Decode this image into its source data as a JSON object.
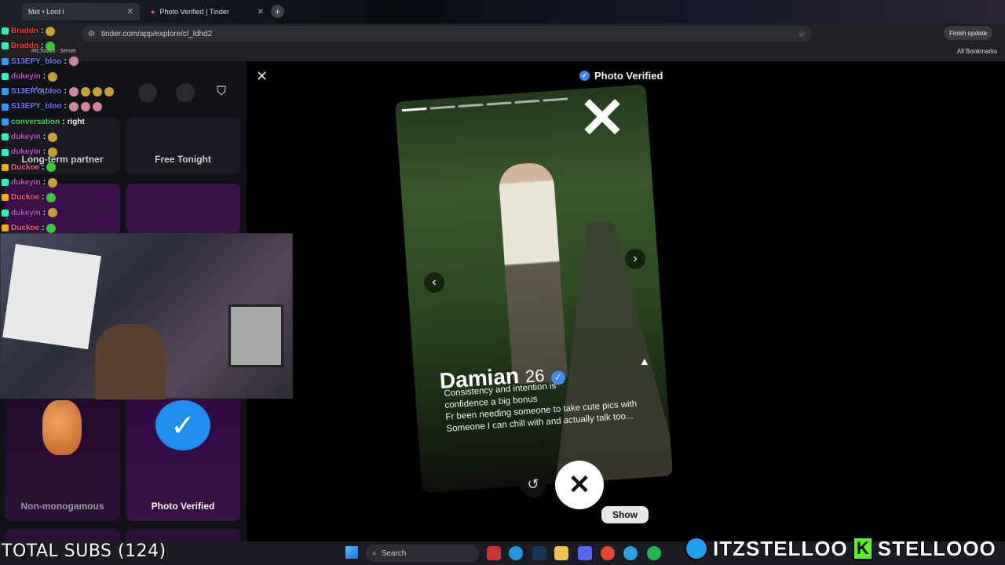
{
  "browser": {
    "tabs": [
      {
        "label": "Met • Lord i",
        "active": true
      },
      {
        "label": "Photo Verified | Tinder",
        "active": false
      }
    ],
    "url": "tinder.com/app/explore/cl_ldhd2",
    "finish_update": "Finish update",
    "bookmark_item": "IRLToolkit - Server",
    "all_bookmarks": "All Bookmarks"
  },
  "chat": [
    {
      "user": "Braddn",
      "color": "#ff3b3b",
      "msg": "",
      "emote": true
    },
    {
      "user": "Braddn",
      "color": "#ff3b3b",
      "msg": "",
      "emote": true
    },
    {
      "user": "S13EPY_bloo",
      "color": "#6f7cff",
      "msg": "",
      "emote": true
    },
    {
      "user": "dukeyin",
      "color": "#d14bd4",
      "msg": "",
      "emote": true
    },
    {
      "user": "S13EPY_bloo",
      "color": "#6f7cff",
      "msg": "",
      "emote": true
    },
    {
      "user": "S13EPY_bloo",
      "color": "#6f7cff",
      "msg": "",
      "emote": true
    },
    {
      "user": "conversation",
      "color": "#44d36a",
      "msg": "right",
      "emote": false
    },
    {
      "user": "dukeyin",
      "color": "#d14bd4",
      "msg": "",
      "emote": true
    },
    {
      "user": "dukeyin",
      "color": "#d14bd4",
      "msg": "",
      "emote": true
    },
    {
      "user": "Duckoe",
      "color": "#ff5b9c",
      "msg": "",
      "emote": true
    },
    {
      "user": "dukeyin",
      "color": "#d14bd4",
      "msg": "",
      "emote": true
    },
    {
      "user": "Duckoe",
      "color": "#ff5b9c",
      "msg": "",
      "emote": true
    },
    {
      "user": "dukeyin",
      "color": "#d14bd4",
      "msg": "",
      "emote": true
    },
    {
      "user": "Duckoe",
      "color": "#ff5b9c",
      "msg": "",
      "emote": true
    }
  ],
  "left_panel": {
    "you_label": "You",
    "cards": [
      {
        "label": "Long-term partner"
      },
      {
        "label": "Free Tonight"
      },
      {
        "label": "Non-monogamous"
      },
      {
        "label": "Photo Verified"
      }
    ]
  },
  "main": {
    "header": "Photo Verified",
    "profile": {
      "name": "Damian",
      "age": "26",
      "bio_line1": "Consistency and intention is",
      "bio_line2": "confidence a big bonus",
      "bio_line3": "Fr been needing someone to take cute pics with",
      "bio_line4": "Someone I can chill with and actually talk too..."
    },
    "show_button": "Show"
  },
  "overlay": {
    "total_subs": "TOTAL SUBS (124)",
    "twitter_handle": "ITZSTELLOO",
    "kick_handle": "STELLOOO"
  },
  "taskbar": {
    "search_label": "Search"
  },
  "colors": {
    "verified_blue": "#3b8cf5",
    "twitter_blue": "#1da1f2",
    "kick_green": "#53fc18"
  }
}
